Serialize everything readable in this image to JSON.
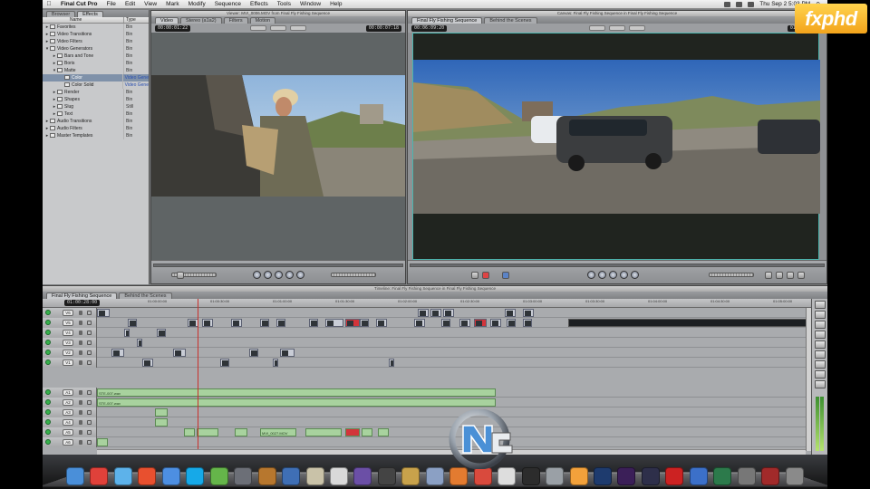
{
  "menubar": {
    "apple": "",
    "app_name": "Final Cut Pro",
    "items": [
      "File",
      "Edit",
      "View",
      "Mark",
      "Modify",
      "Sequence",
      "Effects",
      "Tools",
      "Window",
      "Help"
    ],
    "clock": "Thu Sep 2   5:03 PM"
  },
  "browser": {
    "tabs": [
      "Browser",
      "Effects"
    ],
    "col_name": "Name",
    "col_type": "Type",
    "rows": [
      {
        "name": "Favorites",
        "type": "Bin",
        "indent": 0,
        "open": false
      },
      {
        "name": "Video Transitions",
        "type": "Bin",
        "indent": 0,
        "open": false
      },
      {
        "name": "Video Filters",
        "type": "Bin",
        "indent": 0,
        "open": false
      },
      {
        "name": "Video Generators",
        "type": "Bin",
        "indent": 0,
        "open": true
      },
      {
        "name": "Bars and Tone",
        "type": "Bin",
        "indent": 1,
        "open": false
      },
      {
        "name": "Boris",
        "type": "Bin",
        "indent": 1,
        "open": false
      },
      {
        "name": "Matte",
        "type": "Bin",
        "indent": 1,
        "open": true
      },
      {
        "name": "Color",
        "type": "Video Gene",
        "indent": 2,
        "open": false
      },
      {
        "name": "Color Solid",
        "type": "Video Gene",
        "indent": 2,
        "open": false
      },
      {
        "name": "Render",
        "type": "Bin",
        "indent": 1,
        "open": false
      },
      {
        "name": "Shapes",
        "type": "Bin",
        "indent": 1,
        "open": false
      },
      {
        "name": "Slug",
        "type": "Still",
        "indent": 1,
        "open": false
      },
      {
        "name": "Text",
        "type": "Bin",
        "indent": 1,
        "open": false
      },
      {
        "name": "Audio Transitions",
        "type": "Bin",
        "indent": 0,
        "open": false
      },
      {
        "name": "Audio Filters",
        "type": "Bin",
        "indent": 0,
        "open": false
      },
      {
        "name": "Master Templates",
        "type": "Bin",
        "indent": 0,
        "open": false
      }
    ],
    "selected_index": 7
  },
  "viewer": {
    "title": "Viewer: MVI_0006.MOV from Final Fly Fishing Sequence",
    "tabs": [
      "Video",
      "Stereo (a1a2)",
      "Filters",
      "Motion"
    ],
    "duration_tc": "00:00:01:22",
    "current_tc": "00:00:07:18"
  },
  "canvas": {
    "title": "Canvas: Final Fly Fishing Sequence in Final Fly Fishing Sequence",
    "tabs": [
      "Final Fly Fishing Sequence",
      "Behind the Scenes"
    ],
    "duration_tc": "00:06:09:20",
    "current_tc": "01:00:28:00"
  },
  "timeline": {
    "title": "Timeline: Final Fly Fishing Sequence in Final Fly Fishing Sequence",
    "tabs": [
      "Final Fly Fishing Sequence",
      "Behind the Scenes"
    ],
    "current_tc": "01:00:28:00",
    "ruler": [
      "01:00:00:00",
      "01:00:30:00",
      "01:01:00:00",
      "01:01:30:00",
      "01:02:00:00",
      "01:02:30:00",
      "01:03:00:00",
      "01:03:30:00",
      "01:04:00:00",
      "01:04:30:00",
      "01:05:00:00",
      "01:05:30:00"
    ],
    "video_tracks": [
      "V6",
      "V5",
      "V4",
      "V3",
      "V2",
      "V1"
    ],
    "audio_tracks": [
      "A1",
      "A2",
      "A3",
      "A4",
      "A5",
      "A6"
    ],
    "audio_clip_labels": [
      "STE-007.wav",
      "STE-007.wav",
      "STE-007.wav",
      "STE-007.wav",
      "MVI_0027.MOV",
      "MVI_0027.MOV"
    ]
  },
  "overlay": {
    "fxphd": "fxphd"
  },
  "dock": {
    "apps": [
      "Finder",
      "Chrome",
      "iTunes",
      "Database",
      "Safari",
      "Skype",
      "Evernote",
      "Pen Tool",
      "Keynote",
      "Image",
      "Archive",
      "Mail",
      "Motion",
      "HD",
      "Preview",
      "iPhoto",
      "Photos",
      "iCal",
      "Dictionary",
      "Clapper",
      "Compressor",
      "Color",
      "Photoshop",
      "After Effects",
      "Lightroom",
      "Acrobat",
      "Network",
      "Time Machine",
      "Screenshot",
      "Cube",
      "Trash"
    ],
    "colors": [
      "#4a8fd9",
      "#e0413a",
      "#5db2ea",
      "#e8502f",
      "#4d8fe2",
      "#16a9e8",
      "#65b54a",
      "#6c6f77",
      "#b7772e",
      "#3f6fb5",
      "#c9c2a8",
      "#d9d9d9",
      "#6b4fa6",
      "#444",
      "#c8a24b",
      "#8ba0c4",
      "#e37b30",
      "#d94a3d",
      "#ddd",
      "#2c2c2c",
      "#9aa0a6",
      "#f2a13b",
      "#1e3b6e",
      "#3b1f58",
      "#2e2f4a",
      "#c22",
      "#3c70c9",
      "#2c7a4b",
      "#777",
      "#a12a2a",
      "#8a8a8a"
    ]
  }
}
